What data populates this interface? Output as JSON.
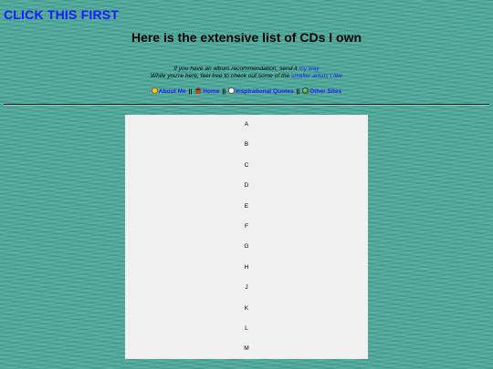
{
  "header": {
    "click_first": "CLICK THIS FIRST",
    "title": "Here is the extensive list of CDs I own"
  },
  "intro": {
    "line1_text": "If you have an album recommendation, send it ",
    "line1_link": "my way",
    "line2_text": "While you're here, feel free to check out some of the ",
    "line2_link": "smaller artists I like"
  },
  "nav": {
    "items": [
      {
        "icon": "smiley-face-icon",
        "label": "About Me"
      },
      {
        "icon": "house-icon",
        "label": "Home"
      },
      {
        "icon": "speech-bubble-icon",
        "label": "Inspirational Quotes"
      },
      {
        "icon": "globe-icon",
        "label": "Other Sites"
      }
    ],
    "separator": "||"
  },
  "letters": [
    "A",
    "B",
    "C",
    "D",
    "E",
    "F",
    "G",
    "H",
    "J",
    "K",
    "L",
    "M"
  ]
}
